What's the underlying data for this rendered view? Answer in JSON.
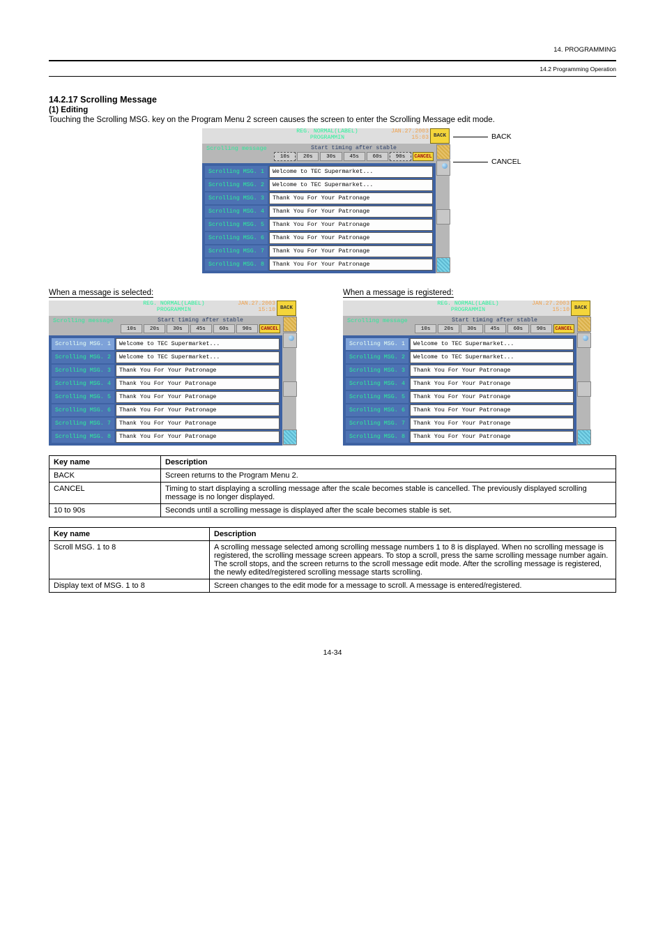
{
  "page": {
    "header_right": "14.  PROGRAMMING",
    "subheader_right": "14.2  Programming Operation",
    "section1": "14.2.17  Scrolling Message",
    "section2": "(1)  Editing",
    "body_text": "Touching the Scrolling MSG. key on the Program Menu 2 screen causes the screen to enter the Scrolling Message edit mode.",
    "footer": "14-34"
  },
  "screen": {
    "title_l1": "REG.  NORMAL(LABEL)",
    "title_l2": "PROGRAMMIN",
    "date_l1": "JAN.27.2003",
    "time_single": "15:03",
    "time_pair": "15:10",
    "back": "BACK",
    "heading": "Scrolling message",
    "subheading": "Start timing after stable",
    "timing": [
      "10s",
      "20s",
      "30s",
      "45s",
      "60s",
      "90s"
    ],
    "cancel": "CANCEL",
    "row_label_prefix": "Scrolling MSG.",
    "rows": [
      {
        "n": "1",
        "msg": "Welcome to TEC Supermarket..."
      },
      {
        "n": "2",
        "msg": "Welcome to TEC Supermarket..."
      },
      {
        "n": "3",
        "msg": "Thank You For Your Patronage"
      },
      {
        "n": "4",
        "msg": "Thank You For Your Patronage"
      },
      {
        "n": "5",
        "msg": "Thank You For Your Patronage"
      },
      {
        "n": "6",
        "msg": "Thank You For Your Patronage"
      },
      {
        "n": "7",
        "msg": "Thank You For Your Patronage"
      },
      {
        "n": "8",
        "msg": "Thank You For Your Patronage"
      }
    ]
  },
  "callouts": {
    "back": "BACK",
    "cancel": "CANCEL"
  },
  "pair": {
    "left_label": "When a message is selected:",
    "right_label": "When a message is registered:"
  },
  "table1": {
    "h1": "Key name",
    "h2": "Description",
    "rows": [
      {
        "k": "BACK",
        "d": "Screen returns to the Program Menu 2."
      },
      {
        "k": "CANCEL",
        "d": "Timing to start displaying a scrolling message after the scale becomes stable is cancelled.  The previously displayed scrolling message is no longer displayed."
      },
      {
        "k": "10 to 90s",
        "d": "Seconds until a scrolling message is displayed after the scale becomes stable is set."
      }
    ]
  },
  "table2": {
    "h1": "Key name",
    "h2": "Description",
    "rows": [
      {
        "k": "Scroll MSG. 1 to 8",
        "d": "A scrolling message selected among scrolling message numbers 1 to 8 is displayed.  When no scrolling message is registered, the scrolling message screen appears.  To stop a scroll, press the same scrolling message number again.  The scroll stops, and the screen returns to the scroll message edit mode.  After the scrolling message is registered, the newly edited/registered scrolling message starts scrolling."
      },
      {
        "k": "Display text of MSG. 1 to 8",
        "d": "Screen changes to the edit mode for a message to scroll.  A message is entered/registered."
      }
    ]
  }
}
